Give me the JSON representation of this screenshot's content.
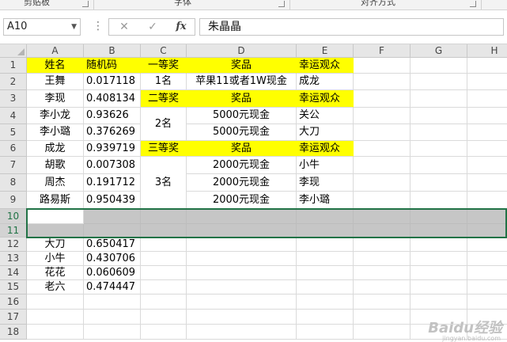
{
  "ribbon": {
    "groups": [
      "剪贴板",
      "字体",
      "对齐方式"
    ]
  },
  "formula_bar": {
    "name_box": "A10",
    "cancel_icon": "✕",
    "enter_icon": "✓",
    "fx_label": "fx",
    "value": "朱晶晶"
  },
  "columns": [
    "A",
    "B",
    "C",
    "D",
    "E",
    "F",
    "G",
    "H"
  ],
  "rows": [
    "1",
    "2",
    "3",
    "4",
    "5",
    "6",
    "7",
    "8",
    "9",
    "10",
    "11",
    "12",
    "13",
    "14",
    "15",
    "16",
    "17",
    "18"
  ],
  "cells": {
    "A1": "姓名",
    "B1": "随机码",
    "C1": "一等奖",
    "D1": "奖品",
    "E1": "幸运观众",
    "A2": "王舞",
    "B2": "0.017118",
    "C2": "1名",
    "D2": "苹果11或者1W现金",
    "E2": "成龙",
    "A3": "李现",
    "B3": "0.408134",
    "C3": "二等奖",
    "D3": "奖品",
    "E3": "幸运观众",
    "A4": "李小龙",
    "B4": "0.93626",
    "C4": "2名",
    "D4": "5000元现金",
    "E4": "关公",
    "A5": "李小璐",
    "B5": "0.376269",
    "D5": "5000元现金",
    "E5": "大刀",
    "A6": "成龙",
    "B6": "0.939719",
    "C6": "三等奖",
    "D6": "奖品",
    "E6": "幸运观众",
    "A7": "胡歌",
    "B7": "0.007308",
    "C7": "3名",
    "D7": "2000元现金",
    "E7": "小牛",
    "A8": "周杰",
    "B8": "0.191712",
    "D8": "2000元现金",
    "E8": "李现",
    "A9": "路易斯",
    "B9": "0.950439",
    "D9": "2000元现金",
    "E9": "李小璐",
    "A12": "大刀",
    "B12": "0.650417",
    "A13": "小牛",
    "B13": "0.430706",
    "A14": "花花",
    "B14": "0.060609",
    "A15": "老六",
    "B15": "0.474447"
  },
  "watermark": {
    "brand": "Baidu经验",
    "url": "jingyan.baidu.com"
  },
  "colors": {
    "highlight": "#ffff00",
    "selection": "#217346",
    "selected_row_fill": "#c6c6c6"
  }
}
